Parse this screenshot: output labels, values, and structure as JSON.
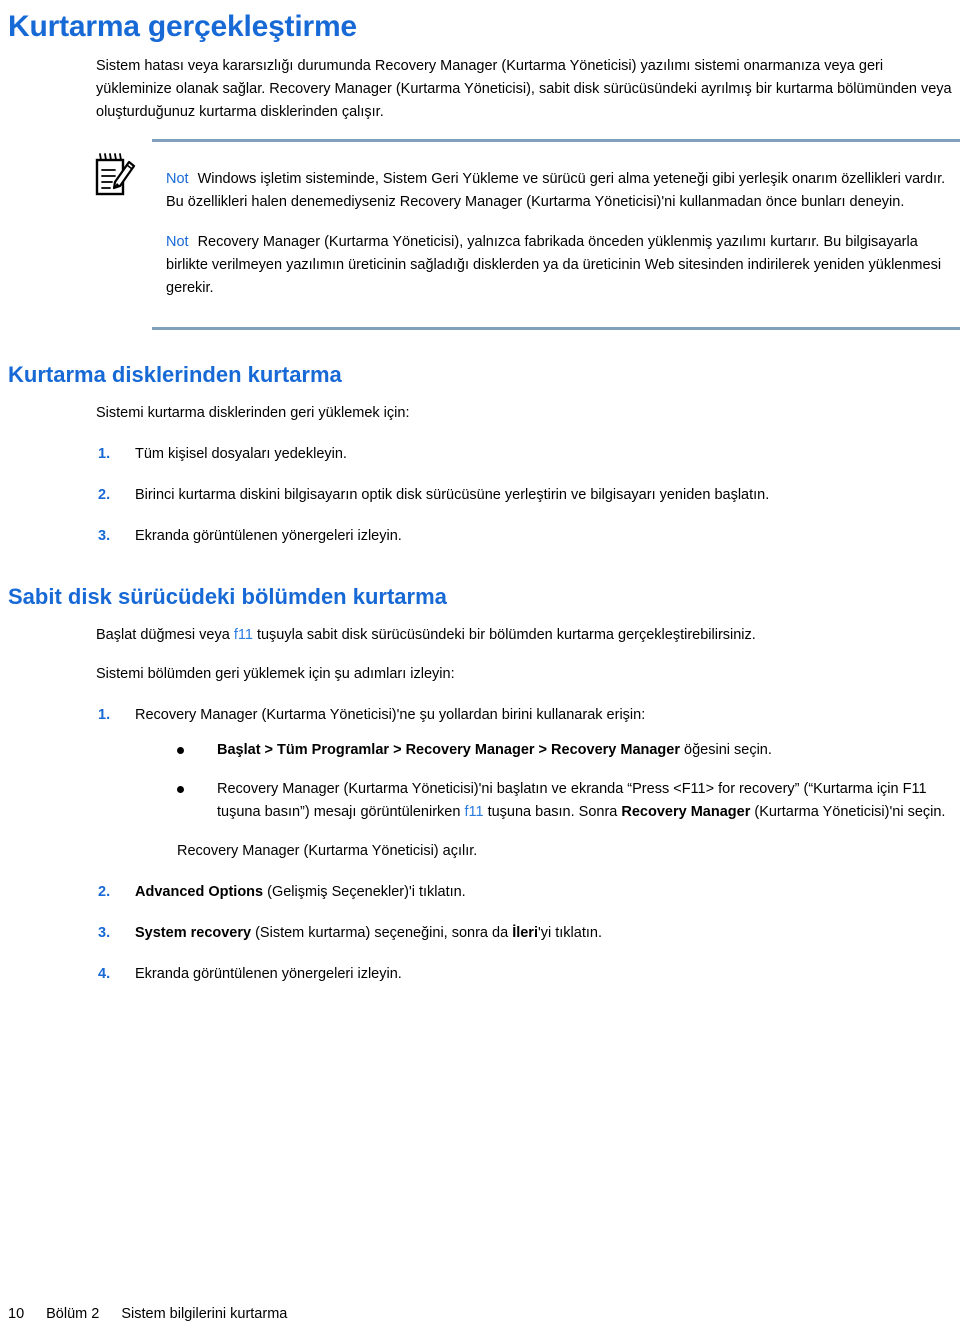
{
  "document": {
    "title": "Kurtarma gerçekleştirme",
    "intro": "Sistem hatası veya kararsızlığı durumunda Recovery Manager (Kurtarma Yöneticisi) yazılımı sistemi onarmanıza veya geri yükleminize olanak sağlar. Recovery Manager (Kurtarma Yöneticisi), sabit disk sürücüsündeki ayrılmış bir kurtarma bölümünden veya oluşturduğunuz kurtarma disklerinden çalışır."
  },
  "note_box": {
    "icon": "note-pencil-icon",
    "divider_color": "#7f9fba",
    "label_color": "#1769d6",
    "notes": [
      {
        "label": "Not",
        "text": "Windows işletim sisteminde, Sistem Geri Yükleme ve sürücü geri alma yeteneği gibi yerleşik onarım özellikleri vardır. Bu özellikleri halen denemediyseniz Recovery Manager (Kurtarma Yöneticisi)'ni kullanmadan önce bunları deneyin."
      },
      {
        "label": "Not",
        "text": "Recovery Manager (Kurtarma Yöneticisi), yalnızca fabrikada önceden yüklenmiş yazılımı kurtarır. Bu bilgisayarla birlikte verilmeyen yazılımın üreticinin sağladığı disklerden ya da üreticinin Web sitesinden indirilerek yeniden yüklenmesi gerekir."
      }
    ]
  },
  "section_discs": {
    "heading": "Kurtarma disklerinden kurtarma",
    "lead": "Sistemi kurtarma disklerinden geri yüklemek için:",
    "steps": [
      {
        "num": "1.",
        "text": "Tüm kişisel dosyaları yedekleyin."
      },
      {
        "num": "2.",
        "text": "Birinci kurtarma diskini bilgisayarın optik disk sürücüsüne yerleştirin ve bilgisayarı yeniden başlatın."
      },
      {
        "num": "3.",
        "text": "Ekranda görüntülenen yönergeleri izleyin."
      }
    ]
  },
  "section_partition": {
    "heading": "Sabit disk sürücüdeki bölümden kurtarma",
    "intro_pre": "Başlat düğmesi veya ",
    "intro_key": "f11",
    "intro_post": " tuşuyla sabit disk sürücüsündeki bir bölümden kurtarma gerçekleştirebilirsiniz.",
    "lead": "Sistemi bölümden geri yüklemek için şu adımları izleyin:",
    "step1": {
      "num": "1.",
      "text": "Recovery Manager (Kurtarma Yöneticisi)'ne şu yollardan birini kullanarak erişin:"
    },
    "bullet1": {
      "bold": "Başlat > Tüm Programlar > Recovery Manager > Recovery Manager",
      "rest": " öğesini seçin."
    },
    "bullet2": {
      "part1": "Recovery Manager (Kurtarma Yöneticisi)'ni başlatın ve ekranda “Press <F11> for recovery” (“Kurtarma için F11 tuşuna basın”) mesajı görüntülenirken ",
      "key": "f11",
      "part2": " tuşuna basın. Sonra ",
      "bold": "Recovery Manager",
      "part3": " (Kurtarma Yöneticisi)'ni seçin."
    },
    "after_bullets": "Recovery Manager (Kurtarma Yöneticisi) açılır.",
    "steps_rest": [
      {
        "num": "2.",
        "bold": "Advanced Options",
        "rest": " (Gelişmiş Seçenekler)'i tıklatın."
      },
      {
        "num": "3.",
        "bold": "System recovery",
        "mid": " (Sistem kurtarma) seçeneğini, sonra da ",
        "bold2": "İleri",
        "rest": "'yi tıklatın."
      },
      {
        "num": "4.",
        "bold": "",
        "rest": "Ekranda görüntülenen yönergeleri izleyin."
      }
    ]
  },
  "footer": {
    "page_number": "10",
    "chapter": "Bölüm 2",
    "chapter_title": "Sistem bilgilerini kurtarma"
  }
}
